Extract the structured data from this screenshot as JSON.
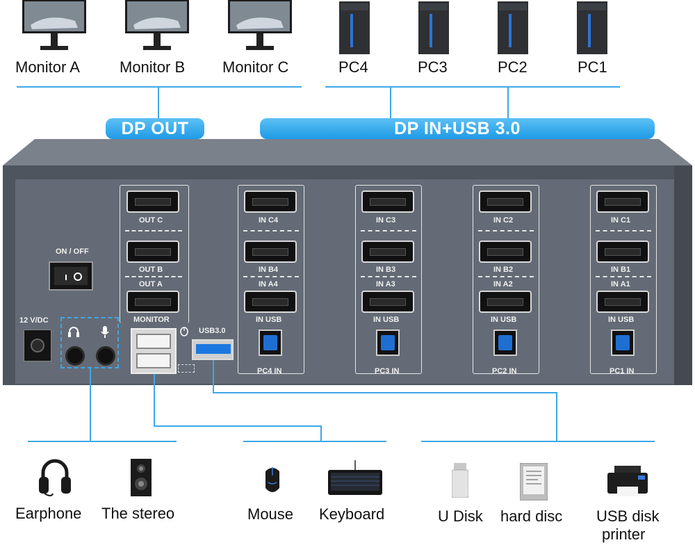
{
  "top": {
    "monitors": [
      "Monitor A",
      "Monitor B",
      "Monitor C"
    ],
    "pcs": [
      "PC4",
      "PC3",
      "PC2",
      "PC1"
    ]
  },
  "banners": {
    "dp_out": "DP OUT",
    "dp_in": "DP IN+USB 3.0"
  },
  "panel": {
    "power": "ON / OFF",
    "dc": "12 V/DC",
    "usb30": "USB3.0",
    "outputs": [
      "OUT C",
      "OUT B",
      "OUT A"
    ],
    "monitor": "MONITOR",
    "pc_groups": [
      {
        "in1": "IN C4",
        "in2": "IN B4",
        "in3": "IN A4",
        "usb": "IN USB",
        "footer": "PC4 IN"
      },
      {
        "in1": "IN C3",
        "in2": "IN B3",
        "in3": "IN A3",
        "usb": "IN USB",
        "footer": "PC3 IN"
      },
      {
        "in1": "IN C2",
        "in2": "IN B2",
        "in3": "IN A2",
        "usb": "IN USB",
        "footer": "PC2 IN"
      },
      {
        "in1": "IN C1",
        "in2": "IN B1",
        "in3": "IN A1",
        "usb": "IN USB",
        "footer": "PC1 IN"
      }
    ]
  },
  "bottom": {
    "devices": [
      "Earphone",
      "The stereo",
      "Mouse",
      "Keyboard",
      "U Disk",
      "hard disc",
      "USB disk",
      "printer"
    ]
  },
  "colors": {
    "accent": "#2b9fe8",
    "panel": "#5d6470"
  }
}
